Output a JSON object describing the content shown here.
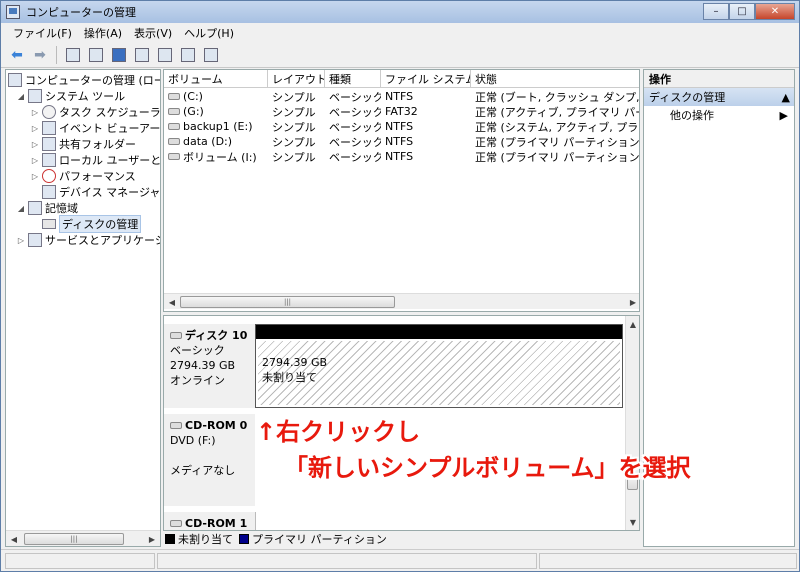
{
  "window": {
    "title": "コンピューターの管理"
  },
  "menu": [
    "ファイル(F)",
    "操作(A)",
    "表示(V)",
    "ヘルプ(H)"
  ],
  "tree": {
    "root": "コンピューターの管理 (ローカ",
    "system_tools": "システム ツール",
    "task_scheduler": "タスク スケジューラ",
    "event_viewer": "イベント ビューアー",
    "shared_folders": "共有フォルダー",
    "local_users": "ローカル ユーザーとグ",
    "performance": "パフォーマンス",
    "device_manager": "デバイス マネージャー",
    "storage": "記憶域",
    "disk_management": "ディスクの管理",
    "services": "サービスとアプリケーショ"
  },
  "volume_list": {
    "headers": [
      "ボリューム",
      "レイアウト",
      "種類",
      "ファイル システム",
      "状態"
    ],
    "rows": [
      [
        "(C:)",
        "シンプル",
        "ベーシック",
        "NTFS",
        "正常 (ブート, クラッシュ ダンプ, プラ"
      ],
      [
        "(G:)",
        "シンプル",
        "ベーシック",
        "FAT32",
        "正常 (アクティブ, プライマリ パーティ"
      ],
      [
        "backup1 (E:)",
        "シンプル",
        "ベーシック",
        "NTFS",
        "正常 (システム, アクティブ, プライマ"
      ],
      [
        "data (D:)",
        "シンプル",
        "ベーシック",
        "NTFS",
        "正常 (プライマリ パーティション)"
      ],
      [
        "ボリューム (I:)",
        "シンプル",
        "ベーシック",
        "NTFS",
        "正常 (プライマリ パーティション)"
      ]
    ]
  },
  "disks": {
    "disk10": {
      "name": "ディスク 10",
      "type": "ベーシック",
      "size": "2794.39 GB",
      "status": "オンライン"
    },
    "partition": {
      "size": "2794.39 GB",
      "label": "未割り当て"
    },
    "cdrom0": {
      "name": "CD-ROM 0",
      "drive": "DVD (F:)",
      "media": "メディアなし"
    },
    "cdrom1": {
      "name": "CD-ROM 1"
    }
  },
  "legend": {
    "unallocated": "未割り当て",
    "primary": "プライマリ パーティション"
  },
  "actions": {
    "header": "操作",
    "section": "ディスクの管理",
    "other": "他の操作"
  },
  "annotation": {
    "line1": "↑右クリックし",
    "line2": "「新しいシンプルボリューム」を選択"
  },
  "colors": {
    "annotation": "#e8190d",
    "primary_partition": "#00008b",
    "unallocated": "#000000"
  }
}
